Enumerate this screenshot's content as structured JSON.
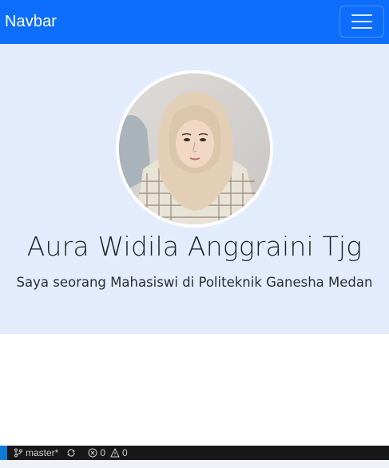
{
  "navbar": {
    "brand": "Navbar",
    "bg_color": "#0d6efd",
    "toggler_icon": "hamburger-icon"
  },
  "hero": {
    "bg_color": "#e3ecfd",
    "avatar_alt": "profile photo",
    "name": "Aura Widila Anggraini Tjg",
    "tagline": "Saya seorang Mahasiswi di Politeknik Ganesha Medan"
  },
  "statusbar": {
    "branch": "master*",
    "branch_icon": "source-control-icon",
    "sync_icon": "sync-icon",
    "errors": "0",
    "warnings": "0",
    "error_icon": "error-circle-icon",
    "warning_icon": "warning-triangle-icon"
  }
}
